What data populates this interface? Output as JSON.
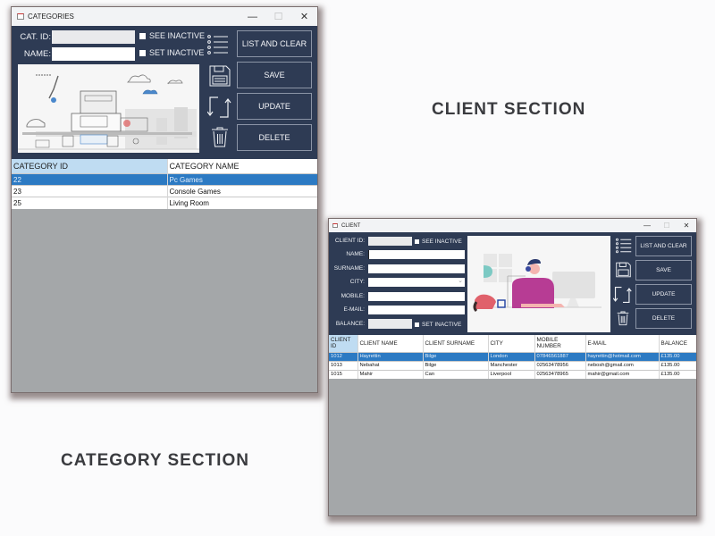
{
  "labels": {
    "client_section": "CLIENT SECTION",
    "category_section": "CATEGORY SECTION"
  },
  "category_window": {
    "title": "CATEGORIES",
    "controls": {
      "minimize": "—",
      "maximize": "☐",
      "close": "✕"
    },
    "form": {
      "cat_id_label": "CAT. ID:",
      "cat_id_value": "",
      "name_label": "NAME:",
      "name_value": "",
      "see_inactive_label": "SEE INACTIVE",
      "see_inactive_checked": false,
      "set_inactive_label": "SET INACTIVE",
      "set_inactive_checked": false
    },
    "illustration": "factory-production-line-illustration",
    "buttons": {
      "list_and_clear": "LIST AND CLEAR",
      "save": "SAVE",
      "update": "UPDATE",
      "delete": "DELETE"
    },
    "icons": [
      "list-icon",
      "floppy-disk-icon",
      "refresh-arrows-icon",
      "trash-icon"
    ],
    "table": {
      "columns": [
        "CATEGORY ID",
        "CATEGORY NAME"
      ],
      "rows": [
        {
          "id": "22",
          "name": "Pc Games",
          "selected": true
        },
        {
          "id": "23",
          "name": "Console Games",
          "selected": false
        },
        {
          "id": "25",
          "name": "Living Room",
          "selected": false
        }
      ]
    }
  },
  "client_window": {
    "title": "CLIENT",
    "controls": {
      "minimize": "—",
      "maximize": "☐",
      "close": "✕"
    },
    "form": {
      "client_id_label": "CLIENT ID:",
      "client_id_value": "",
      "see_inactive_label": "SEE INACTIVE",
      "name_label": "NAME:",
      "name_value": "",
      "surname_label": "SURNAME:",
      "surname_value": "",
      "city_label": "CITY:",
      "city_value": "",
      "mobile_label": "MOBILE:",
      "mobile_value": "",
      "email_label": "E-MAIL:",
      "email_value": "",
      "balance_label": "BALANCE:",
      "balance_value": "",
      "set_inactive_label": "SET INACTIVE"
    },
    "illustration": "call-center-agent-illustration",
    "buttons": {
      "list_and_clear": "LIST AND CLEAR",
      "save": "SAVE",
      "update": "UPDATE",
      "delete": "DELETE"
    },
    "table": {
      "columns": [
        "CLIENT ID",
        "CLIENT NAME",
        "CLIENT SURNAME",
        "CITY",
        "MOBILE NUMBER",
        "E-MAIL",
        "BALANCE"
      ],
      "rows": [
        {
          "id": "1012",
          "name": "Hayrettin",
          "surname": "Bilge",
          "city": "London",
          "mobile": "07846561887",
          "email": "hayrettin@hotmail.com",
          "balance": "£135.00",
          "selected": true
        },
        {
          "id": "1013",
          "name": "Nebahat",
          "surname": "Bilge",
          "city": "Manchester",
          "mobile": "02563478956",
          "email": "nebosh@gmail.com",
          "balance": "£135.00",
          "selected": false
        },
        {
          "id": "1015",
          "name": "Mahir",
          "surname": "Can",
          "city": "Liverpool",
          "mobile": "02563478965",
          "email": "mahir@gmail.com",
          "balance": "£135.00",
          "selected": false
        }
      ]
    }
  }
}
